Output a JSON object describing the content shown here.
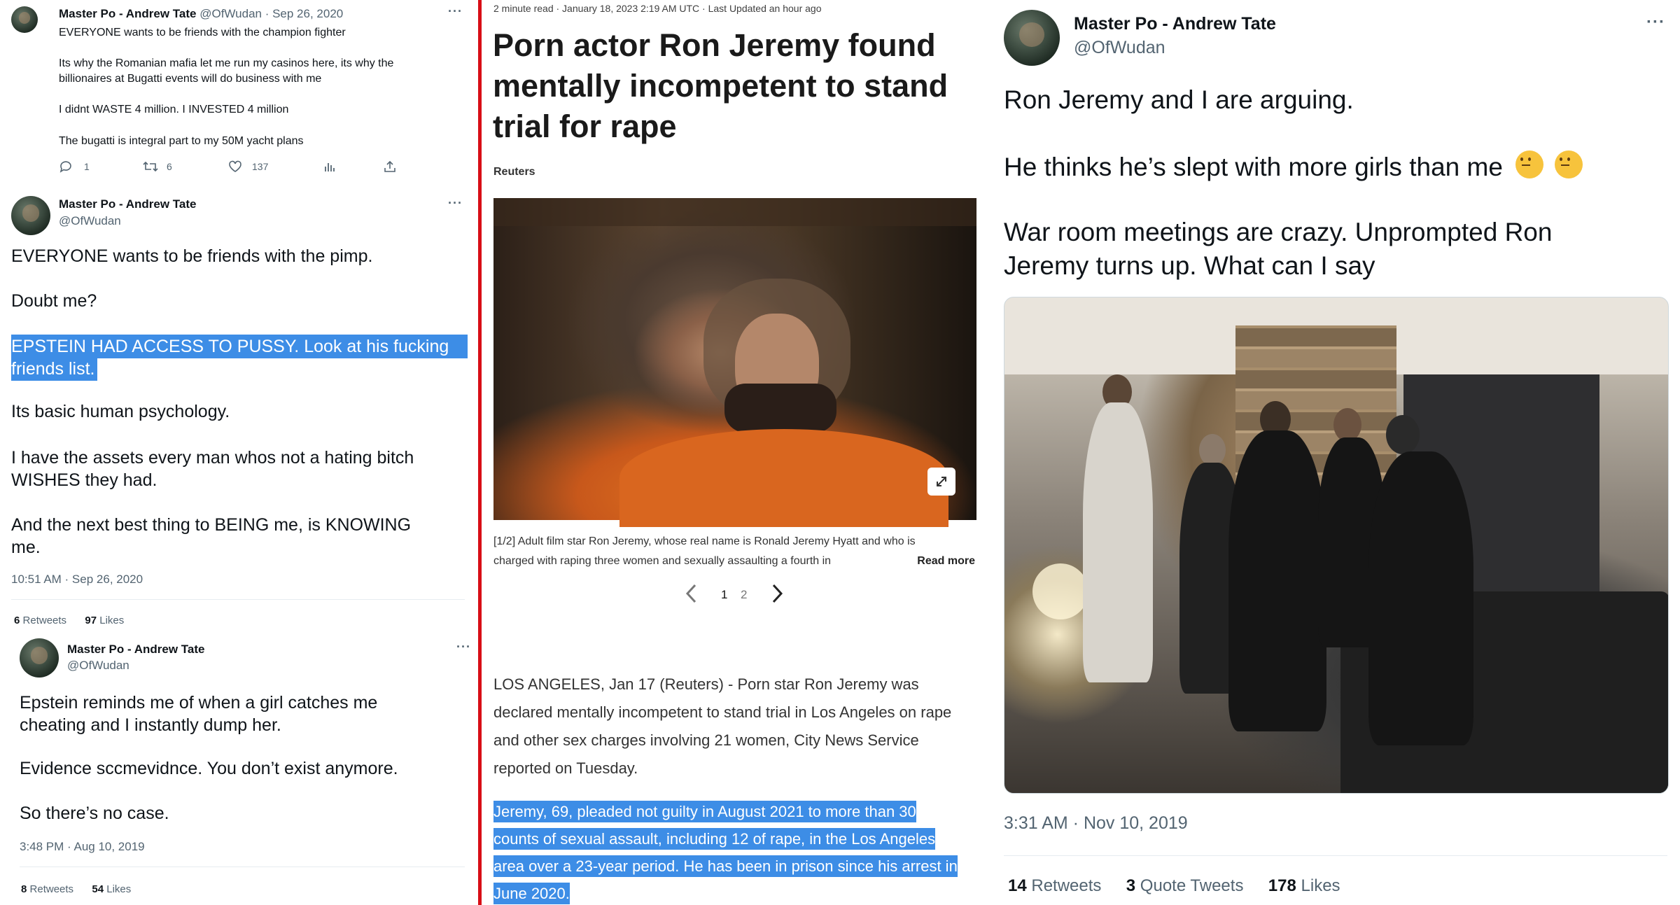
{
  "left": {
    "tweet1": {
      "name": "Master Po - Andrew Tate",
      "handle_date": "@OfWudan · Sep 26, 2020",
      "lines": [
        "EVERYONE wants to be friends with the champion fighter",
        "Its why the Romanian mafia let me run my casinos here, its why the",
        "billionaires at Bugatti events will do business with me",
        "I didnt WASTE 4 million. I INVESTED 4 million",
        "The bugatti is integral part to my 50M yacht plans"
      ],
      "replies": "1",
      "retweets": "6",
      "likes": "137"
    },
    "tweet2": {
      "name": "Master Po - Andrew Tate",
      "handle": "@OfWudan",
      "line1": "EVERYONE wants to be friends with the pimp.",
      "line2": "Doubt me?",
      "sel1": "EPSTEIN HAD ACCESS TO PUSSY. Look at his fucking",
      "sel2": "friends list.",
      "line3": "Its basic human psychology.",
      "line4a": "I have the assets every man whos not a hating bitch",
      "line4b": "WISHES they had.",
      "line5a": "And the next best thing to BEING me, is KNOWING",
      "line5b": "me.",
      "time": "10:51 AM · Sep 26, 2020",
      "retweets_num": "6",
      "retweets_label": "Retweets",
      "likes_num": "97",
      "likes_label": "Likes"
    },
    "tweet3": {
      "name": "Master Po - Andrew Tate",
      "handle": "@OfWudan",
      "line1a": "Epstein reminds me of when a girl catches me",
      "line1b": "cheating and I instantly dump her.",
      "line2": "Evidence sccmevidnce. You don’t exist anymore.",
      "line3": "So there’s no case.",
      "time": "3:48 PM · Aug 10, 2019",
      "retweets_num": "8",
      "retweets_label": "Retweets",
      "likes_num": "54",
      "likes_label": "Likes"
    }
  },
  "article": {
    "meta": "2 minute read · January 18, 2023 2:19 AM UTC · Last Updated an hour ago",
    "headline": [
      "Porn actor Ron Jeremy found",
      "mentally incompetent to stand",
      "trial for rape"
    ],
    "source": "Reuters",
    "caption1": "[1/2] Adult film star Ron Jeremy, whose real name is Ronald Jeremy Hyatt and who is",
    "caption2": "charged with raping three women and sexually assaulting a fourth in",
    "read_more": "Read more",
    "page1": "1",
    "page2": "2",
    "para1": [
      "LOS ANGELES, Jan 17 (Reuters) - Porn star Ron Jeremy was",
      "declared mentally incompetent to stand trial in Los Angeles on rape",
      "and other sex charges involving 21 women, City News Service",
      "reported on Tuesday."
    ],
    "para2": [
      "Jeremy, 69, pleaded not guilty in August 2021 to more than 30",
      "counts of sexual assault, including 12 of rape, in the Los Angeles",
      "area over a 23-year period. He has been in prison since his arrest in",
      "June 2020."
    ]
  },
  "right": {
    "name": "Master Po - Andrew Tate",
    "handle": "@OfWudan",
    "line1": "Ron Jeremy and I are arguing.",
    "line2": "He thinks he’s slept with more girls than me",
    "line3a": "War room meetings are crazy. Unprompted Ron",
    "line3b": "Jeremy turns up. What can I say",
    "time": "3:31 AM · Nov 10, 2019",
    "retweets_num": "14",
    "retweets_label": "Retweets",
    "quotes_num": "3",
    "quotes_label": "Quote Tweets",
    "likes_num": "178",
    "likes_label": "Likes"
  },
  "colors": {
    "selection": "#3d8de6",
    "divider": "#d80e16",
    "muted": "#536471"
  },
  "icons": [
    "reply-icon",
    "retweet-icon",
    "like-icon",
    "views-icon",
    "share-icon",
    "more-icon",
    "expand-icon",
    "chevron-left-icon",
    "chevron-right-icon",
    "thinking-face-icon"
  ]
}
